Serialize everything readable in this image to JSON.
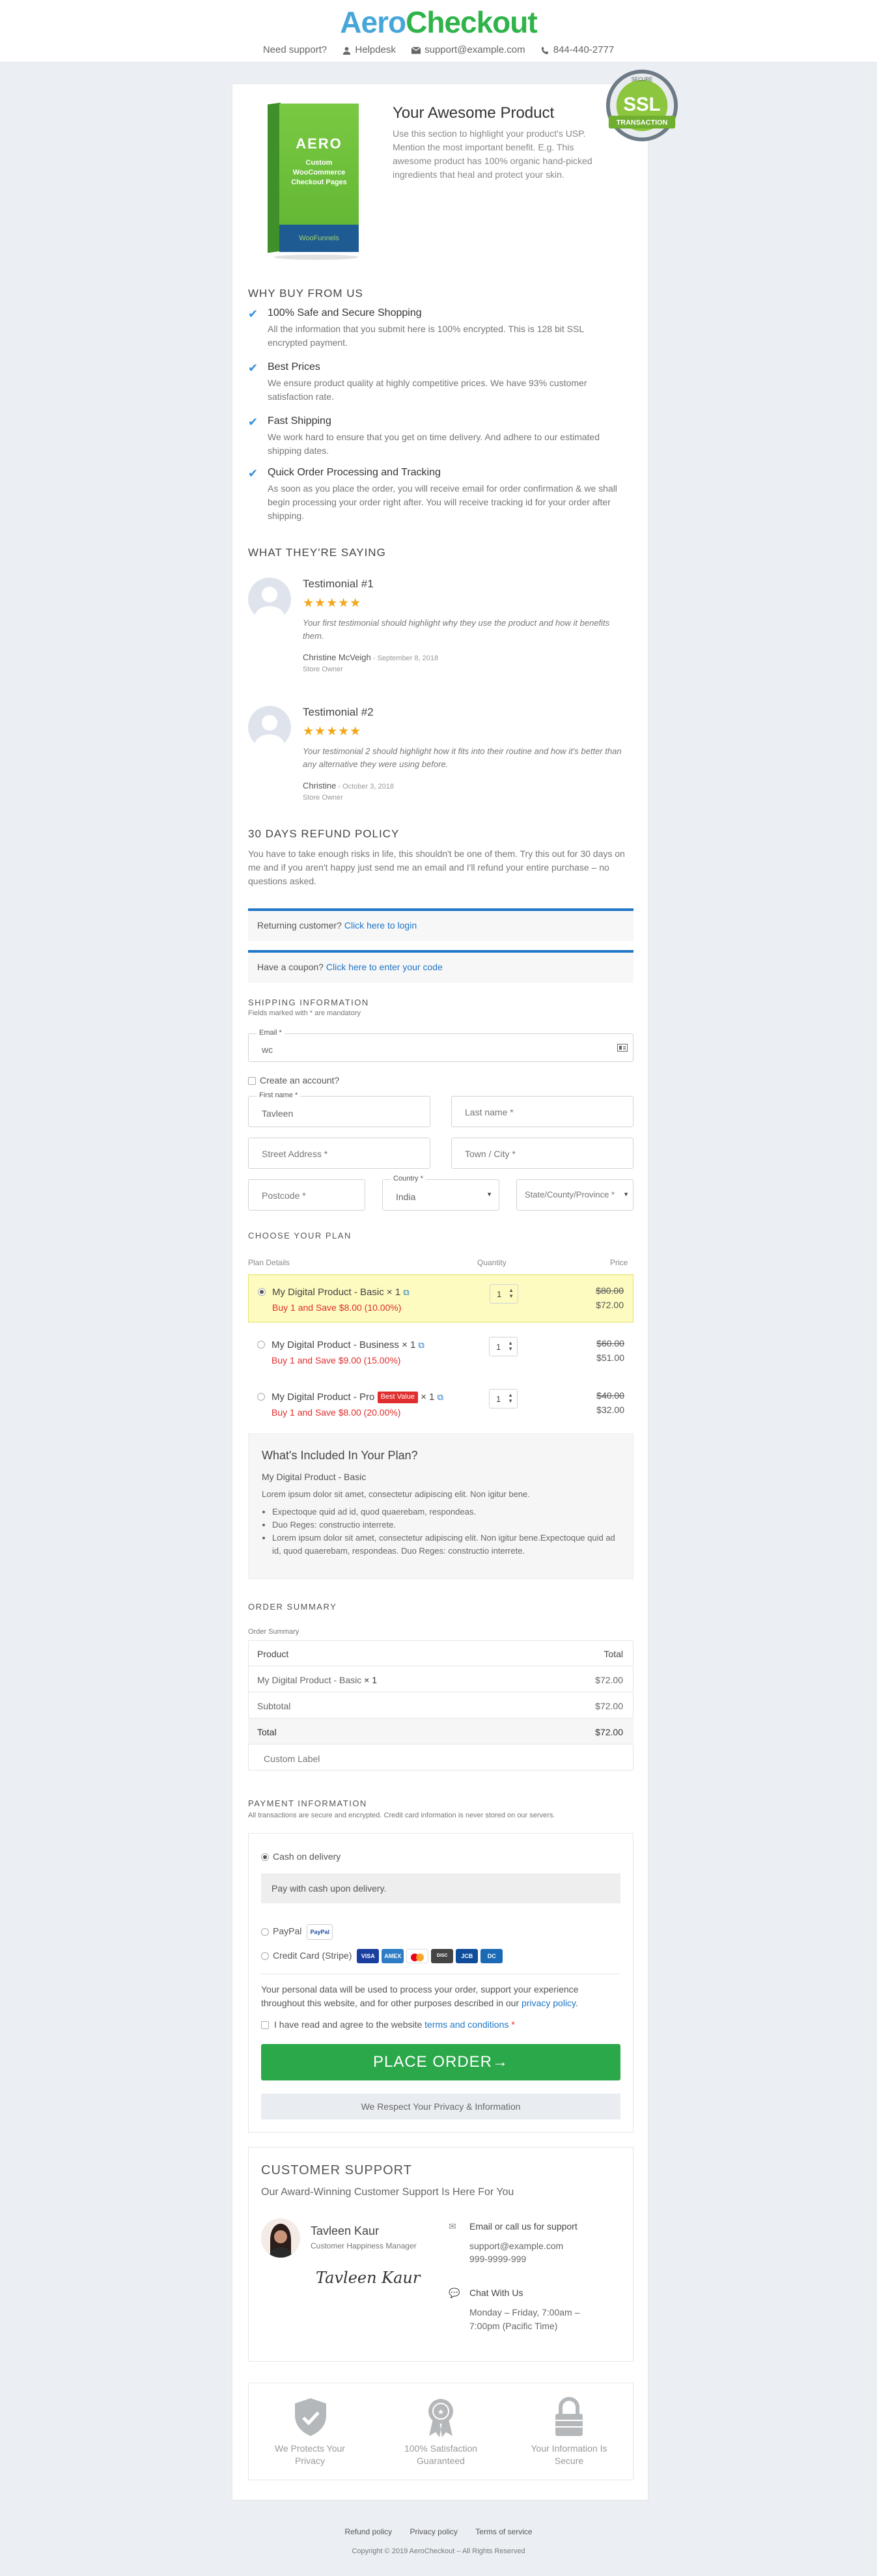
{
  "header": {
    "logo_part1": "Aero",
    "logo_part2": "Checkout",
    "need_support": "Need support?",
    "helpdesk": "Helpdesk",
    "email": "support@example.com",
    "phone": "844-440-2777"
  },
  "ssl_badge": {
    "top": "SECURE",
    "main": "SSL",
    "bottom": "TRANSACTION"
  },
  "product": {
    "box_brand": "AERO",
    "box_line1": "Custom",
    "box_line2": "WooCommerce",
    "box_line3": "Checkout Pages",
    "box_footer": "WooFunnels",
    "title": "Your Awesome Product",
    "description": "Use this section to highlight your product's USP. Mention the most important benefit. E.g. This awesome product has 100% organic hand-picked ingredients that heal and protect your skin."
  },
  "why_buy": {
    "heading": "WHY BUY FROM US",
    "items": [
      {
        "title": "100% Safe and Secure Shopping",
        "desc": "All the information that you submit here is 100% encrypted. This is 128 bit SSL encrypted payment."
      },
      {
        "title": "Best Prices",
        "desc": "We ensure product quality at highly competitive prices. We have 93% customer satisfaction rate."
      },
      {
        "title": "Fast Shipping",
        "desc": "We work hard to ensure that you get on time delivery. And adhere to our estimated shipping dates."
      },
      {
        "title": "Quick Order Processing and Tracking",
        "desc": "As soon as you place the order, you will receive email for order confirmation & we shall begin processing your order right after. You will receive tracking id for your order after shipping."
      }
    ]
  },
  "testimonials": {
    "heading": "WHAT THEY'RE SAYING",
    "items": [
      {
        "title": "Testimonial #1",
        "stars": "★★★★★",
        "rating": 5,
        "text": "Your first testimonial should highlight why they use the product and how it benefits them.",
        "name": "Christine McVeigh",
        "date": " - September 8, 2018",
        "role": "Store Owner"
      },
      {
        "title": "Testimonial #2",
        "stars": "★★★★★",
        "rating": 5,
        "text": "Your testimonial 2 should highlight how it fits into their routine and how it's better than any alternative they were using before.",
        "name": "Christine",
        "date": " - October 3, 2018",
        "role": "Store Owner"
      }
    ]
  },
  "refund": {
    "heading": "30 DAYS REFUND POLICY",
    "text": "You have to take enough risks in life, this shouldn't be one of them. Try this out for 30 days on me and if you aren't happy just send me an email and I'll refund your entire purchase – no questions asked."
  },
  "notices": {
    "returning": "Returning customer?",
    "login_link": "Click here to login",
    "coupon": "Have a coupon?",
    "coupon_link": "Click here to enter your code"
  },
  "shipping": {
    "heading": "SHIPPING INFORMATION",
    "mandatory": "Fields marked with * are mandatory",
    "email_label": "Email *",
    "email_value": "wc",
    "create_account": "Create an account?",
    "first_name_label": "First name *",
    "first_name_value": "Tavleen",
    "last_name_ph": "Last name *",
    "street_ph": "Street Address *",
    "town_ph": "Town / City *",
    "postcode_ph": "Postcode *",
    "country_label": "Country *",
    "country_value": "India",
    "state_ph": "State/County/Province *"
  },
  "plans": {
    "heading": "CHOOSE YOUR PLAN",
    "col_details": "Plan Details",
    "col_qty": "Quantity",
    "col_price": "Price",
    "items": [
      {
        "name": "My Digital Product - Basic",
        "qty_label": "× 1",
        "save": "Buy 1 and Save $8.00 (10.00%)",
        "qty": "1",
        "old": "$80.00",
        "new": "$72.00",
        "badge": "",
        "selected": true
      },
      {
        "name": "My Digital Product - Business",
        "qty_label": "× 1",
        "save": "Buy 1 and Save $9.00 (15.00%)",
        "qty": "1",
        "old": "$60.00",
        "new": "$51.00",
        "badge": "",
        "selected": false
      },
      {
        "name": "My Digital Product - Pro",
        "qty_label": "× 1",
        "save": "Buy 1 and Save $8.00 (20.00%)",
        "qty": "1",
        "old": "$40.00",
        "new": "$32.00",
        "badge": "Best Value",
        "selected": false
      }
    ]
  },
  "included": {
    "heading": "What's Included In Your Plan?",
    "subtitle": "My Digital Product - Basic",
    "intro": "Lorem ipsum dolor sit amet, consectetur adipiscing elit. Non igitur bene.",
    "bullets": [
      "Expectoque quid ad id, quod quaerebam, respondeas.",
      "Duo Reges: constructio interrete.",
      "Lorem ipsum dolor sit amet, consectetur adipiscing elit. Non igitur bene.Expectoque quid ad id, quod quaerebam, respondeas. Duo Reges: constructio interrete."
    ]
  },
  "order_summary": {
    "heading": "ORDER SUMMARY",
    "sub": "Order Summary",
    "col_product": "Product",
    "col_total": "Total",
    "item_name": "My Digital Product - Basic",
    "item_qty": "× 1",
    "item_total": "$72.00",
    "subtotal_label": "Subtotal",
    "subtotal": "$72.00",
    "total_label": "Total",
    "total": "$72.00",
    "custom_label": "Custom Label"
  },
  "payment": {
    "heading": "PAYMENT INFORMATION",
    "sub": "All transactions are secure and encrypted. Credit card information is never stored on our servers.",
    "cod": "Cash on delivery",
    "cod_desc": "Pay with cash upon delivery.",
    "paypal": "PayPal",
    "stripe": "Credit Card (Stripe)",
    "privacy_text": "Your personal data will be used to process your order, support your experience throughout this website, and for other purposes described in our",
    "privacy_link": "privacy policy",
    "terms_text": "I have read and agree to the website",
    "terms_link": "terms and conditions",
    "terms_req": "*",
    "place_order": "PLACE ORDER→",
    "respect": "We Respect Your Privacy & Information"
  },
  "support": {
    "heading": "CUSTOMER SUPPORT",
    "sub": "Our Award-Winning Customer Support Is Here For You",
    "agent_name": "Tavleen Kaur",
    "agent_role": "Customer Happiness Manager",
    "signature": "Tavleen Kaur",
    "email_title": "Email or call us for support",
    "email": "support@example.com",
    "phone": "999-9999-999",
    "chat_title": "Chat With Us",
    "chat_hours": "Monday – Friday, 7:00am – 7:00pm (Pacific Time)"
  },
  "trust": [
    {
      "label": "We Protects Your Privacy"
    },
    {
      "label": "100% Satisfaction Guaranteed"
    },
    {
      "label": "Your Information Is Secure"
    }
  ],
  "footer": {
    "refund": "Refund policy",
    "privacy": "Privacy policy",
    "terms": "Terms of service",
    "copyright": "Copyright © 2019 AeroCheckout – All Rights Reserved"
  },
  "colors": {
    "accent": "#1f75c6",
    "green": "#2aa84a",
    "red": "#e02d2d",
    "star": "#f0a81a"
  }
}
